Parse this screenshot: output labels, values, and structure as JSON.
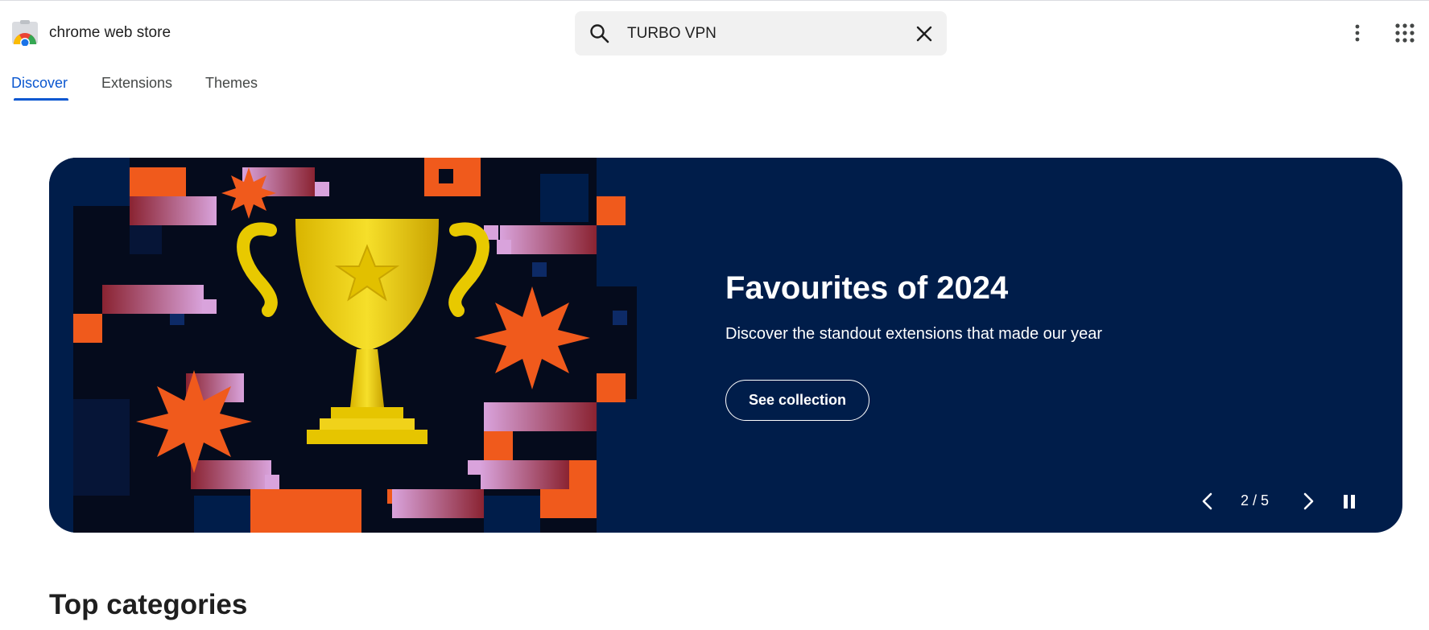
{
  "header": {
    "brand": "chrome web store",
    "search_value": "TURBO VPN"
  },
  "tabs": [
    {
      "label": "Discover",
      "active": true
    },
    {
      "label": "Extensions",
      "active": false
    },
    {
      "label": "Themes",
      "active": false
    }
  ],
  "hero": {
    "title": "Favourites of 2024",
    "subtitle": "Discover the standout extensions that made our year",
    "button_label": "See collection",
    "counter": "2 / 5"
  },
  "sections": {
    "top_categories": "Top categories"
  },
  "colors": {
    "accent": "#0b57d0",
    "hero_bg": "#001d4a",
    "art_orange": "#f05a1c",
    "trophy_gold": "#f2d31a"
  },
  "icons": [
    "chrome-web-store-logo",
    "search-icon",
    "clear-icon",
    "more-vert-icon",
    "apps-grid-icon",
    "chevron-left-icon",
    "chevron-right-icon",
    "pause-icon"
  ]
}
